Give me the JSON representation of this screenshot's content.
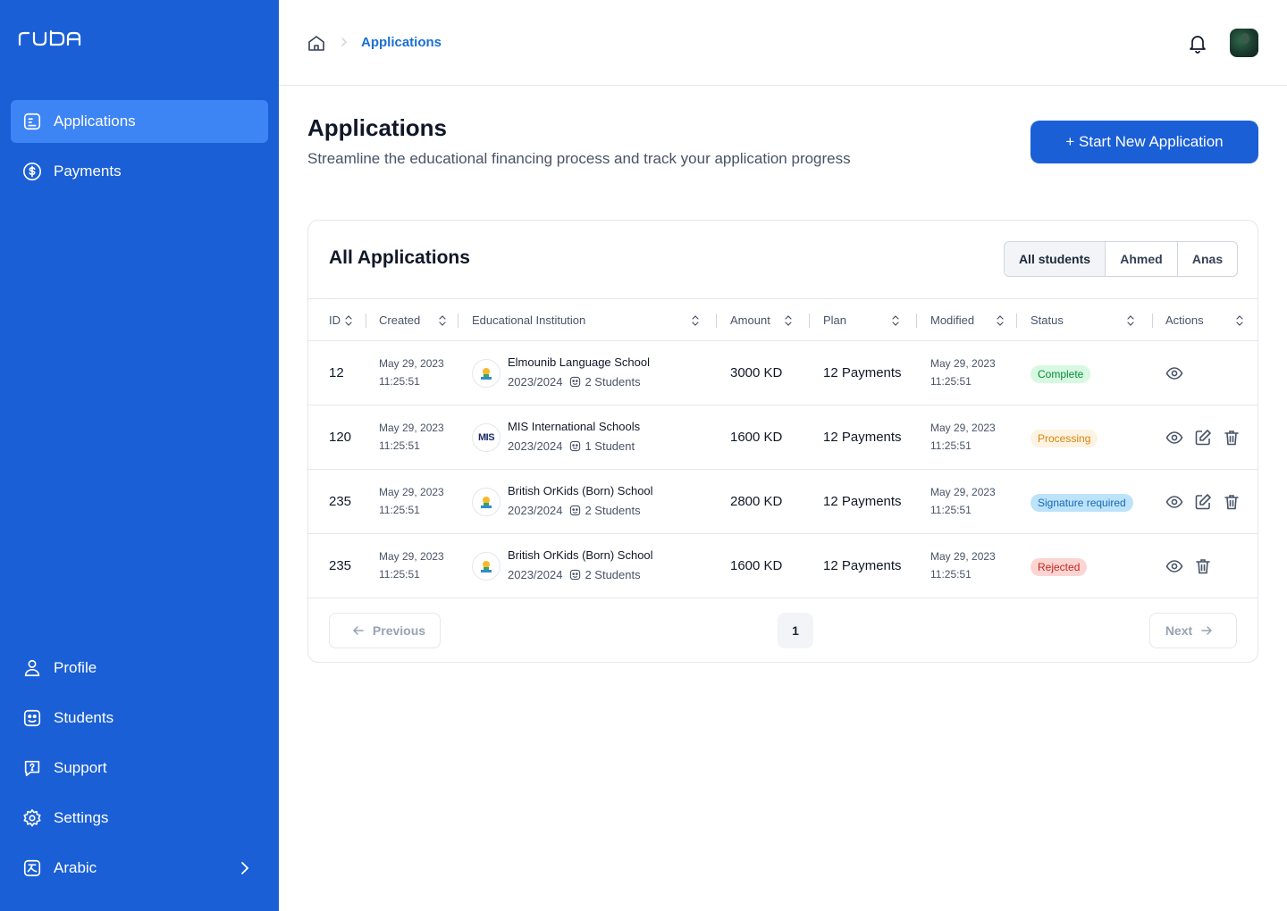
{
  "app": {
    "logo_text": "ruba"
  },
  "sidebar": {
    "top_items": [
      {
        "label": "Applications",
        "icon": "document-icon",
        "active": true
      },
      {
        "label": "Payments",
        "icon": "dollar-circle-icon"
      }
    ],
    "bottom_items": [
      {
        "label": "Profile",
        "icon": "user-icon"
      },
      {
        "label": "Students",
        "icon": "face-icon"
      },
      {
        "label": "Support",
        "icon": "help-chat-icon"
      },
      {
        "label": "Settings",
        "icon": "gear-icon"
      },
      {
        "label": "Arabic",
        "icon": "language-icon"
      }
    ]
  },
  "header": {
    "breadcrumb_current": "Applications"
  },
  "page": {
    "title": "Applications",
    "subtitle": "Streamline the educational financing process and track your application progress",
    "primary_button": "+ Start New Application"
  },
  "card": {
    "title": "All Applications",
    "filters": [
      "All students",
      "Ahmed",
      "Anas"
    ],
    "columns": [
      "ID",
      "Created",
      "Educational Institution",
      "Amount",
      "Plan",
      "Modified",
      "Status",
      "Actions"
    ],
    "rows": [
      {
        "id": "12",
        "created_date": "May 29, 2023",
        "created_time": "11:25:51",
        "institution": "Elmounib Language School",
        "year": "2023/2024",
        "students": "2 Students",
        "amount": "3000 KD",
        "plan": "12 Payments",
        "modified_date": "May 29, 2023",
        "modified_time": "11:25:51",
        "status": "Complete",
        "status_color": "#0b8a3a"
      },
      {
        "id": "120",
        "created_date": "May 29, 2023",
        "created_time": "11:25:51",
        "institution": "MIS International Schools",
        "year": "2023/2024",
        "students": "1 Student",
        "amount": "1600 KD",
        "plan": "12 Payments",
        "modified_date": "May 29, 2023",
        "modified_time": "11:25:51",
        "status": "Processing",
        "status_color": "#d9840a",
        "logo_text": "MIS"
      },
      {
        "id": "235",
        "created_date": "May 29, 2023",
        "created_time": "11:25:51",
        "institution": "British OrKids (Born) School",
        "year": "2023/2024",
        "students": "2 Students",
        "amount": "2800 KD",
        "plan": "12 Payments",
        "modified_date": "May 29, 2023",
        "modified_time": "11:25:51",
        "status": "Signature required",
        "status_color": "#1769b3"
      },
      {
        "id": "235",
        "created_date": "May 29, 2023",
        "created_time": "11:25:51",
        "institution": "British OrKids (Born) School",
        "year": "2023/2024",
        "students": "2 Students",
        "amount": "1600 KD",
        "plan": "12 Payments",
        "modified_date": "May 29, 2023",
        "modified_time": "11:25:51",
        "status": "Rejected",
        "status_color": "#c4261f"
      }
    ],
    "pagination": {
      "previous": "Previous",
      "next": "Next",
      "current_page": "1"
    }
  },
  "colors": {
    "brand": "#1a5fd6",
    "brand_active": "#3d84f5",
    "link": "#1a6fd6"
  }
}
